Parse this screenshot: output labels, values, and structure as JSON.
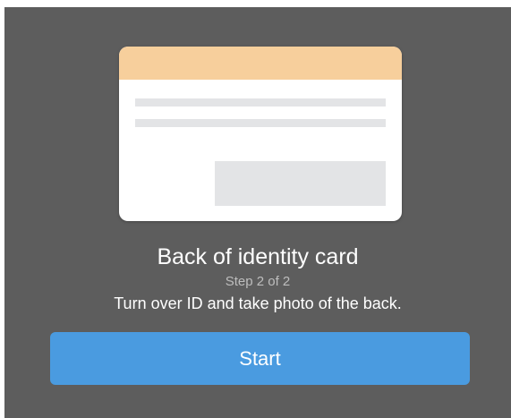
{
  "colors": {
    "background": "#5d5d5d",
    "card_header": "#f7cf9c",
    "card_body": "#ffffff",
    "card_placeholder": "#e3e4e6",
    "button": "#4a9be0"
  },
  "illustration": {
    "icon": "id-card-back-illustration"
  },
  "content": {
    "title": "Back of identity card",
    "step": "Step 2 of 2",
    "description": "Turn over ID and take photo of the back."
  },
  "actions": {
    "start_label": "Start"
  }
}
